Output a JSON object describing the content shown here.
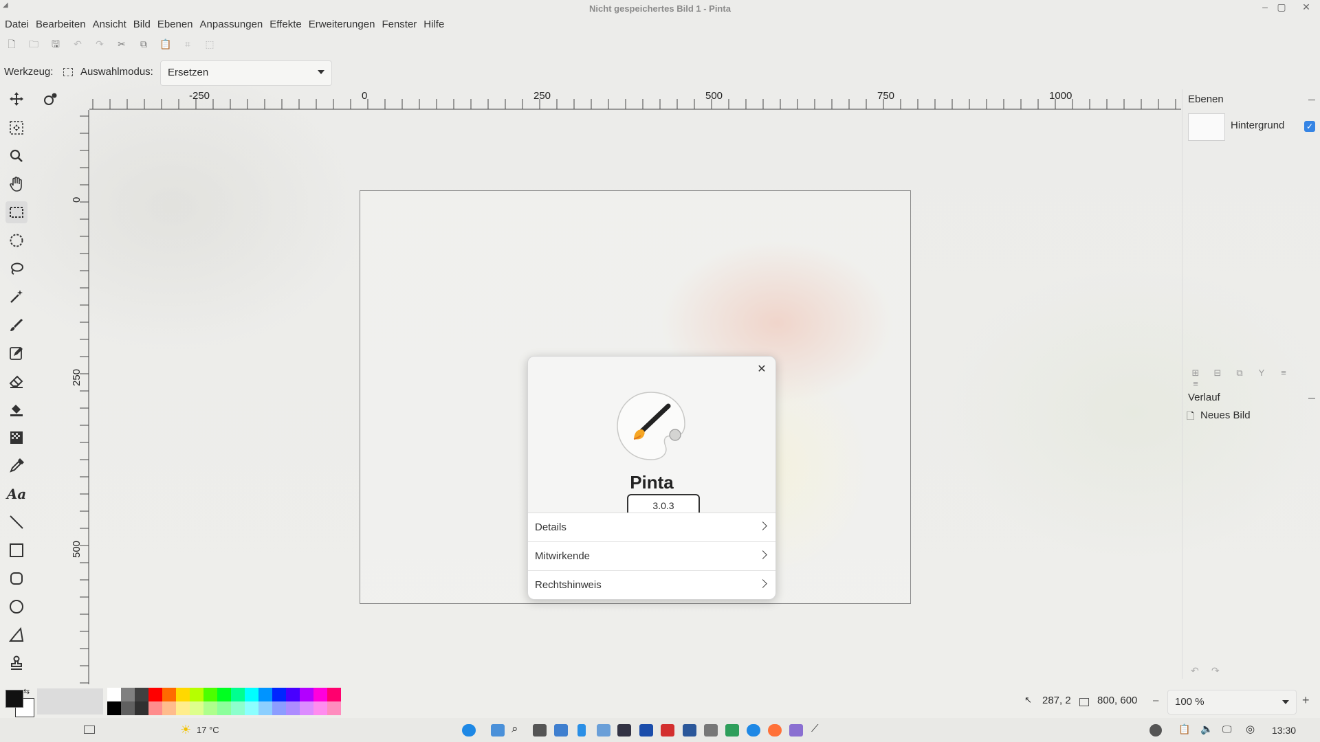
{
  "window": {
    "title": "Nicht gespeichertes Bild 1 - Pinta"
  },
  "menu": [
    "Datei",
    "Bearbeiten",
    "Ansicht",
    "Bild",
    "Ebenen",
    "Anpassungen",
    "Effekte",
    "Erweiterungen",
    "Fenster",
    "Hilfe"
  ],
  "toolbar_icons": [
    "new-icon",
    "open-icon",
    "save-icon",
    "undo-icon",
    "redo-icon",
    "cut-icon",
    "copy-icon",
    "paste-icon",
    "crop-icon",
    "deselect-icon"
  ],
  "tool_options": {
    "tool_label": "Werkzeug:",
    "mode_label": "Auswahlmodus:",
    "mode_value": "Ersetzen"
  },
  "tools": [
    "move-selection-icon",
    "move-selected-icon",
    "zoom-icon",
    "pan-icon",
    "rectangle-select-icon",
    "ellipse-select-icon",
    "lasso-select-icon",
    "magic-wand-icon",
    "paintbrush-icon",
    "pencil-icon",
    "eraser-icon",
    "paint-bucket-icon",
    "gradient-icon",
    "color-picker-icon",
    "text-icon",
    "line-icon",
    "rectangle-icon",
    "rounded-rectangle-icon",
    "ellipse-icon",
    "freeform-shape-icon",
    "clone-stamp-icon"
  ],
  "ruler": {
    "h_labels": [
      "-250",
      "0",
      "250",
      "500",
      "750",
      "1000"
    ],
    "v_labels": [
      "0",
      "250",
      "500"
    ]
  },
  "layers_panel": {
    "title": "Ebenen",
    "layer_name": "Hintergrund"
  },
  "history_panel": {
    "title": "Verlauf",
    "item": "Neues Bild"
  },
  "status": {
    "cursor": "287, 2",
    "selection": "800, 600",
    "zoom": "100 %"
  },
  "about_dialog": {
    "app_name": "Pinta",
    "version": "3.0.3",
    "rows": [
      "Details",
      "Mitwirkende",
      "Rechtshinweis"
    ]
  },
  "palette_colors": [
    "#ffffff",
    "#808080",
    "#404040",
    "#ff0000",
    "#ff6a00",
    "#ffd800",
    "#b6ff00",
    "#4cff00",
    "#00ff21",
    "#00ff90",
    "#00ffff",
    "#0094ff",
    "#0026ff",
    "#4800ff",
    "#b200ff",
    "#ff00dc",
    "#ff006e"
  ],
  "taskbar": {
    "weather": "17 °C",
    "clock": "13:30"
  }
}
